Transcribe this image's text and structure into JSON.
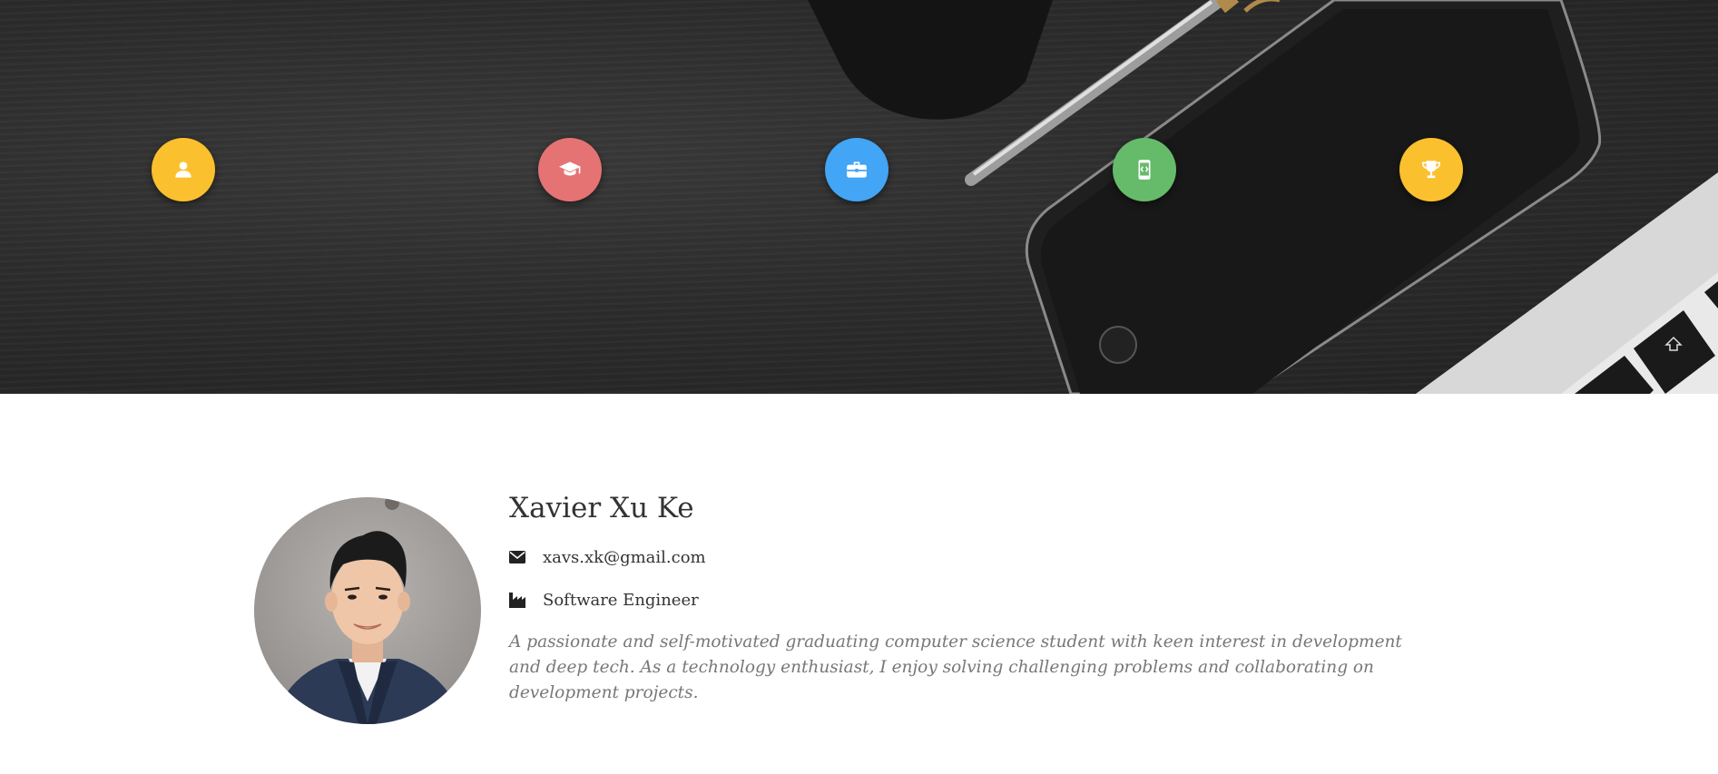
{
  "nav": [
    {
      "name": "profile-nav-button",
      "icon": "person-icon",
      "color": "#FBC02D"
    },
    {
      "name": "education-nav-button",
      "icon": "graduation-cap-icon",
      "color": "#E57373"
    },
    {
      "name": "experience-nav-button",
      "icon": "briefcase-icon",
      "color": "#42A5F5"
    },
    {
      "name": "projects-nav-button",
      "icon": "mobile-code-icon",
      "color": "#66BB6A"
    },
    {
      "name": "awards-nav-button",
      "icon": "trophy-icon",
      "color": "#FBC02D"
    }
  ],
  "profile": {
    "name": "Xavier Xu Ke",
    "email": "xavs.xk@gmail.com",
    "email_icon": "envelope-icon",
    "title": "Software Engineer",
    "title_icon": "industry-icon",
    "bio": "A passionate and self-motivated graduating computer science student with keen interest in development and deep tech. As a technology enthusiast, I enjoy solving challenging problems and collaborating on development projects."
  }
}
